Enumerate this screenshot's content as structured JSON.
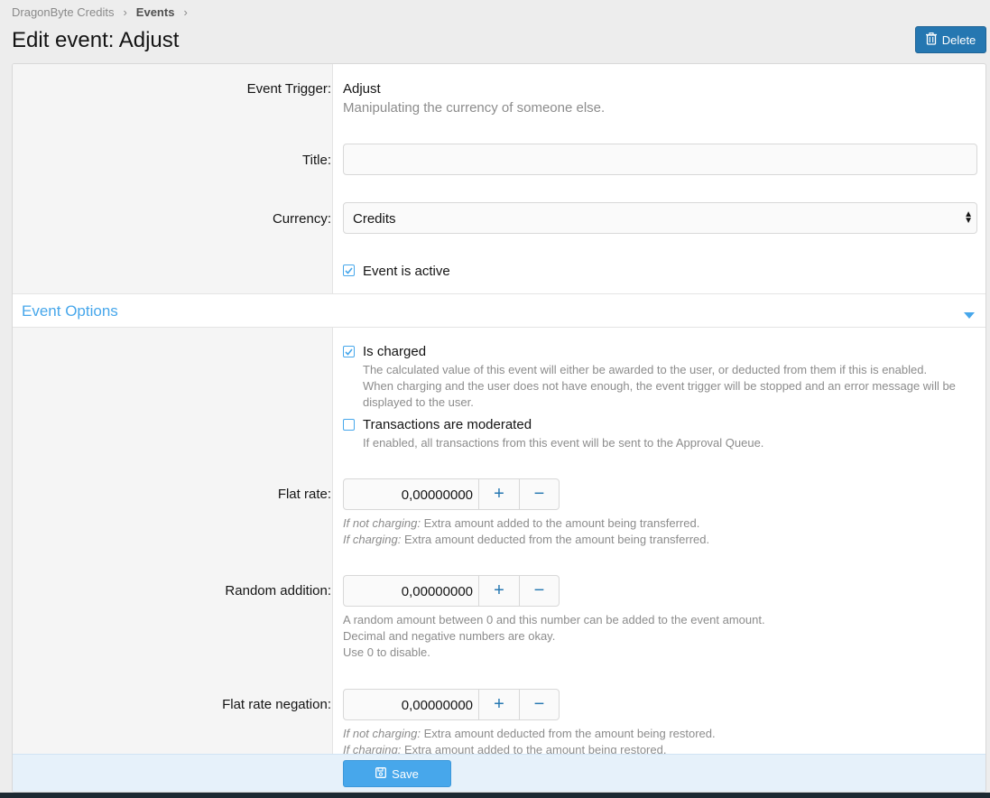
{
  "breadcrumb": {
    "item1": "DragonByte Credits",
    "item2": "Events"
  },
  "page": {
    "title": "Edit event: Adjust"
  },
  "toolbar": {
    "delete_label": "Delete"
  },
  "form": {
    "trigger_label": "Event Trigger:",
    "trigger_name": "Adjust",
    "trigger_desc": "Manipulating the currency of someone else.",
    "title_label": "Title:",
    "title_value": "",
    "currency_label": "Currency:",
    "currency_value": "Credits",
    "active_label": "Event is active",
    "active_checked": true
  },
  "options": {
    "section_title": "Event Options",
    "charged_label": "Is charged",
    "charged_checked": true,
    "charged_hint1": "The calculated value of this event will either be awarded to the user, or deducted from them if this is enabled.",
    "charged_hint2": "When charging and the user does not have enough, the event trigger will be stopped and an error message will be",
    "charged_hint3": "displayed to the user.",
    "moderated_label": "Transactions are moderated",
    "moderated_checked": false,
    "moderated_hint": "If enabled, all transactions from this event will be sent to the Approval Queue.",
    "flat_rate_label": "Flat rate:",
    "flat_rate_value": "0,00000000",
    "flat_rate_hint1_em": "If not charging:",
    "flat_rate_hint1": " Extra amount added to the amount being transferred.",
    "flat_rate_hint2_em": "If charging:",
    "flat_rate_hint2": " Extra amount deducted from the amount being transferred.",
    "random_label": "Random addition:",
    "random_value": "0,00000000",
    "random_hint1": "A random amount between 0 and this number can be added to the event amount.",
    "random_hint2": "Decimal and negative numbers are okay.",
    "random_hint3": "Use 0 to disable.",
    "negation_label": "Flat rate negation:",
    "negation_value": "0,00000000",
    "negation_hint1_em": "If not charging:",
    "negation_hint1": " Extra amount deducted from the amount being restored.",
    "negation_hint2_em": "If charging:",
    "negation_hint2": " Extra amount added to the amount being restored.",
    "plus_symbol": "+",
    "minus_symbol": "−"
  },
  "footer": {
    "save_label": "Save"
  },
  "colors": {
    "accent": "#47a7eb",
    "primary_button": "#2577b1"
  }
}
